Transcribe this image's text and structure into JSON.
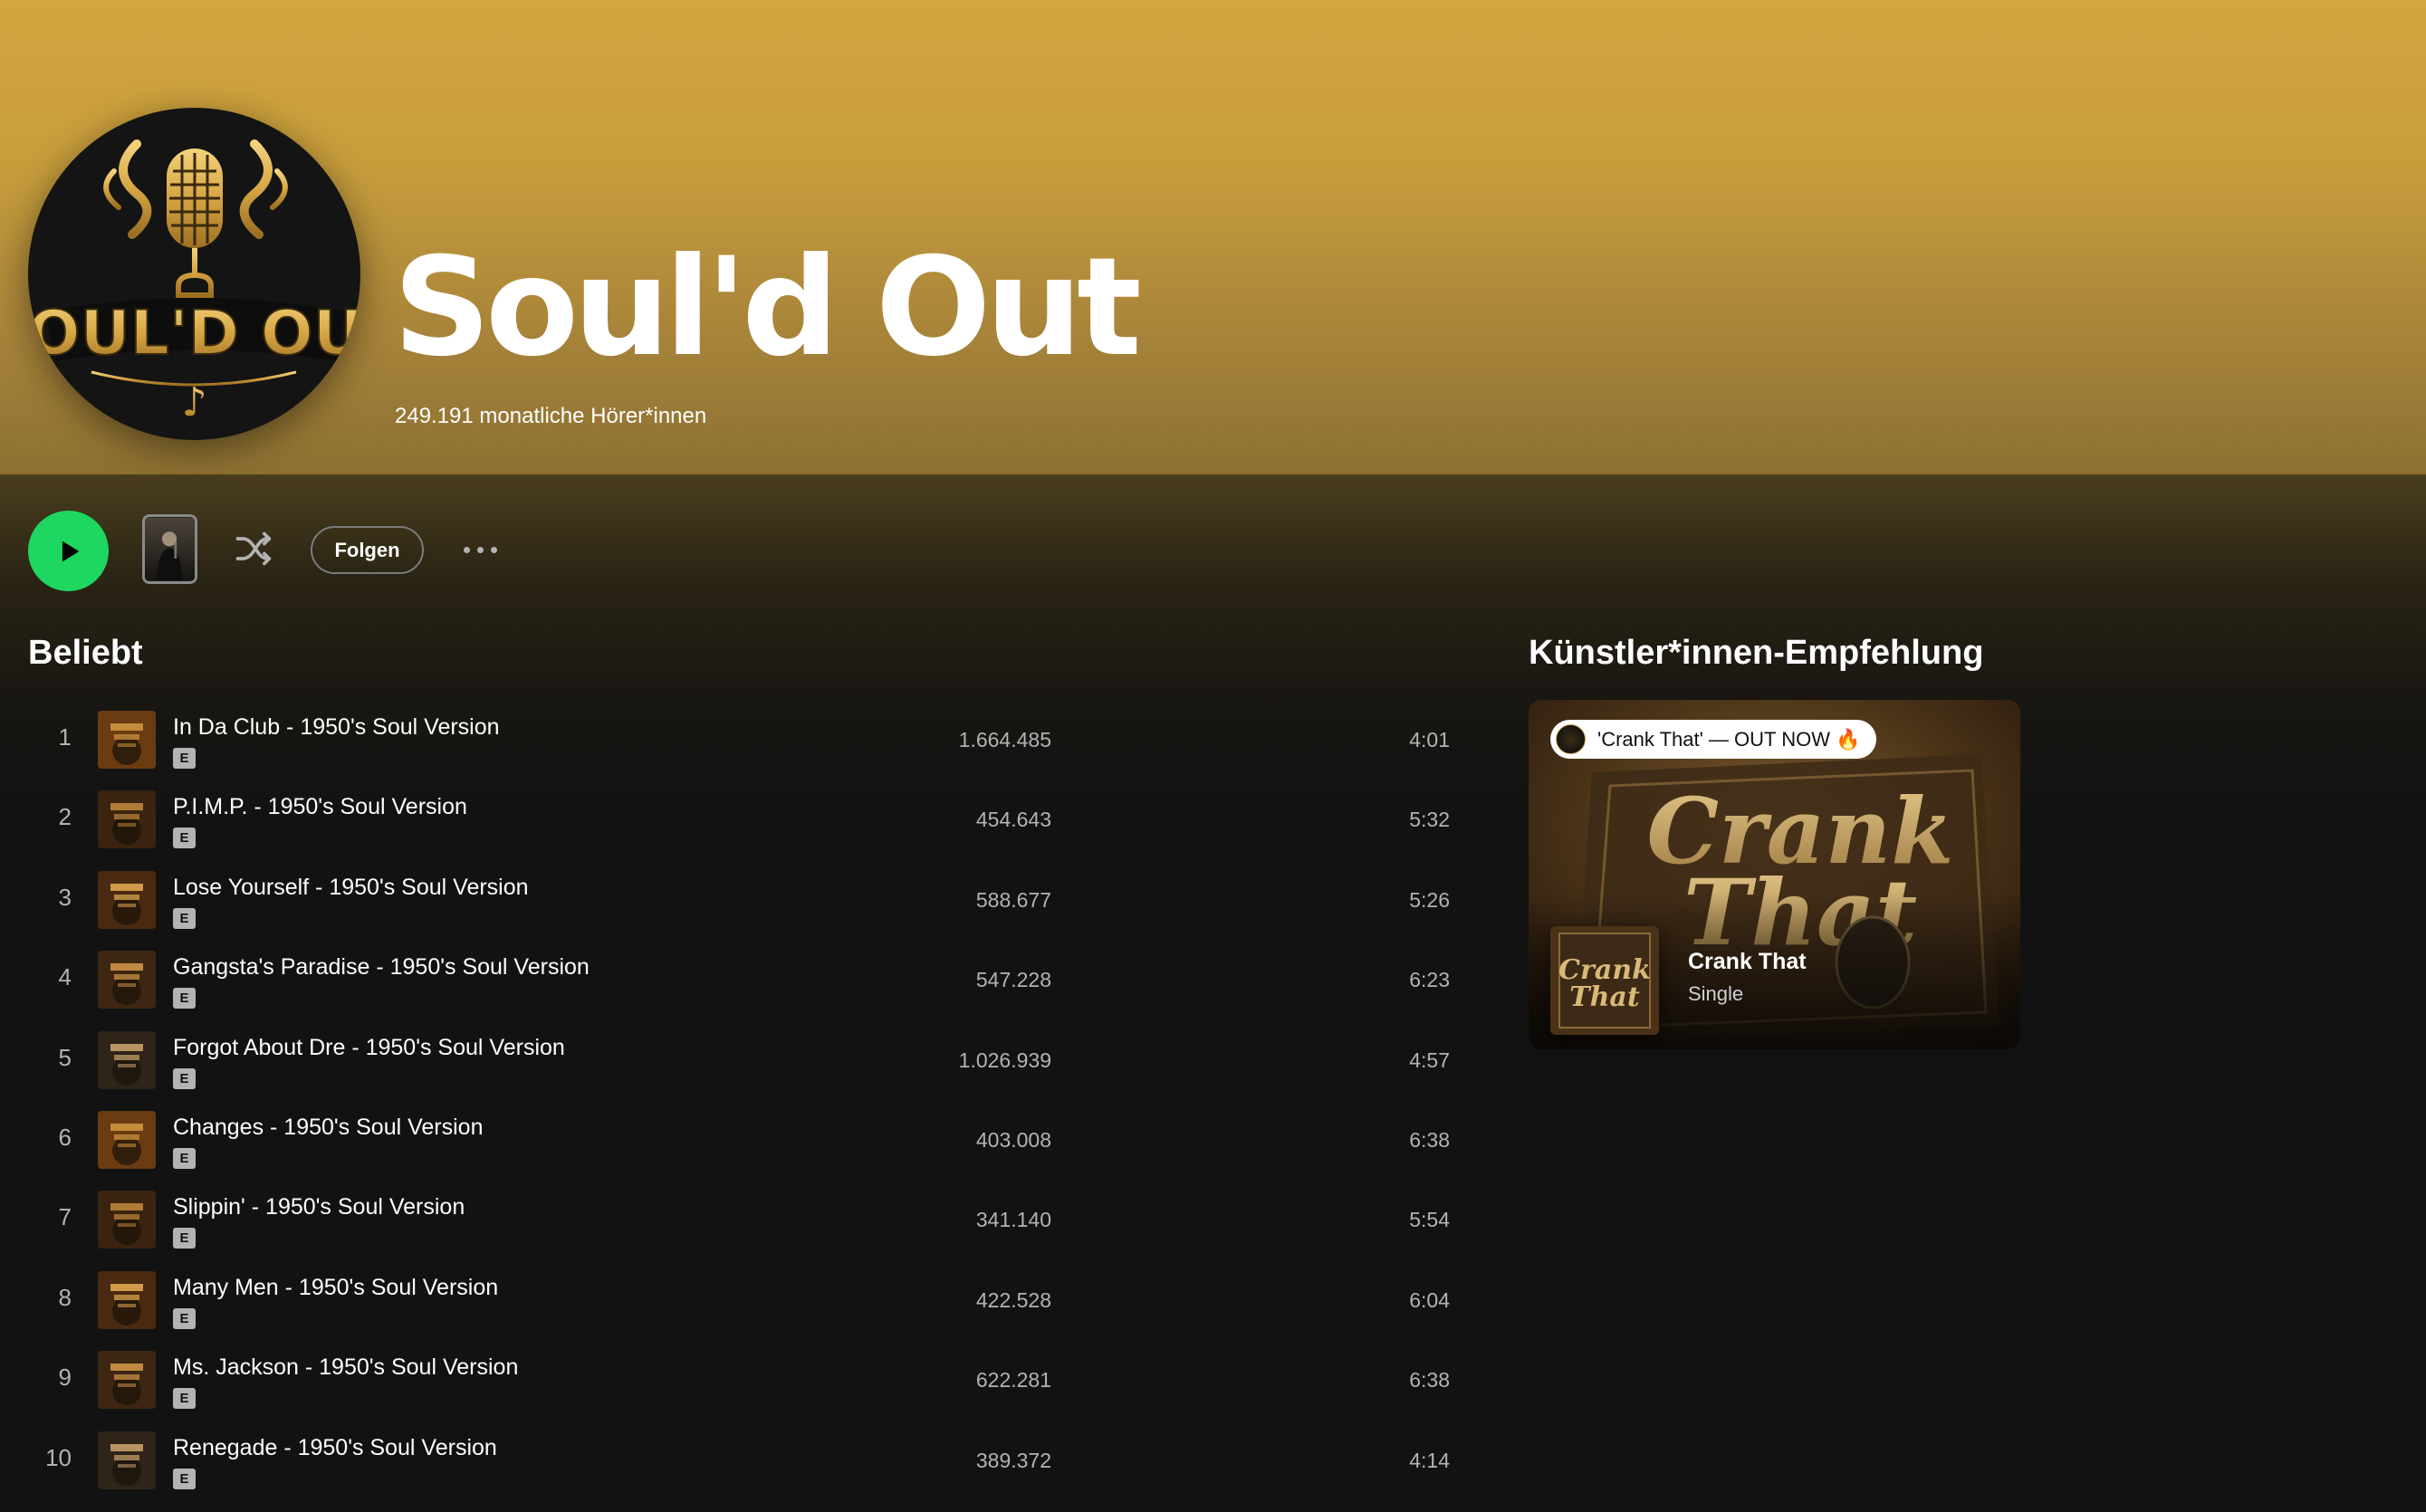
{
  "artist": {
    "name": "Soul'd Out",
    "monthly_listeners": "249.191 monatliche Hörer*innen",
    "logo_text": "SOUL'D OUT"
  },
  "actions": {
    "play_icon": "play-icon",
    "shuffle_icon": "shuffle-icon",
    "follow_label": "Folgen",
    "more_icon": "more-options-icon"
  },
  "popular": {
    "title": "Beliebt",
    "tracks": [
      {
        "num": "1",
        "title": "In Da Club - 1950's Soul Version",
        "explicit": "E",
        "plays": "1.664.485",
        "duration": "4:01"
      },
      {
        "num": "2",
        "title": "P.I.M.P. - 1950's Soul Version",
        "explicit": "E",
        "plays": "454.643",
        "duration": "5:32"
      },
      {
        "num": "3",
        "title": "Lose Yourself - 1950's Soul Version",
        "explicit": "E",
        "plays": "588.677",
        "duration": "5:26"
      },
      {
        "num": "4",
        "title": "Gangsta's Paradise - 1950's Soul Version",
        "explicit": "E",
        "plays": "547.228",
        "duration": "6:23"
      },
      {
        "num": "5",
        "title": "Forgot About Dre - 1950's Soul Version",
        "explicit": "E",
        "plays": "1.026.939",
        "duration": "4:57"
      },
      {
        "num": "6",
        "title": "Changes - 1950's Soul Version",
        "explicit": "E",
        "plays": "403.008",
        "duration": "6:38"
      },
      {
        "num": "7",
        "title": "Slippin' - 1950's Soul Version",
        "explicit": "E",
        "plays": "341.140",
        "duration": "5:54"
      },
      {
        "num": "8",
        "title": "Many Men - 1950's Soul Version",
        "explicit": "E",
        "plays": "422.528",
        "duration": "6:04"
      },
      {
        "num": "9",
        "title": "Ms. Jackson - 1950's Soul Version",
        "explicit": "E",
        "plays": "622.281",
        "duration": "6:38"
      },
      {
        "num": "10",
        "title": "Renegade - 1950's Soul Version",
        "explicit": "E",
        "plays": "389.372",
        "duration": "4:14"
      }
    ]
  },
  "recommendation": {
    "title": "Künstler*innen-Empfehlung",
    "pill_text": "'Crank That' — OUT NOW 🔥",
    "cover_text": [
      "Crank",
      "That"
    ],
    "release_title": "Crank That",
    "release_type": "Single"
  },
  "colors": {
    "header_gold": "#d3a63f",
    "play_green": "#1ed760",
    "background": "#121212",
    "muted_text": "#b3b3b3"
  }
}
